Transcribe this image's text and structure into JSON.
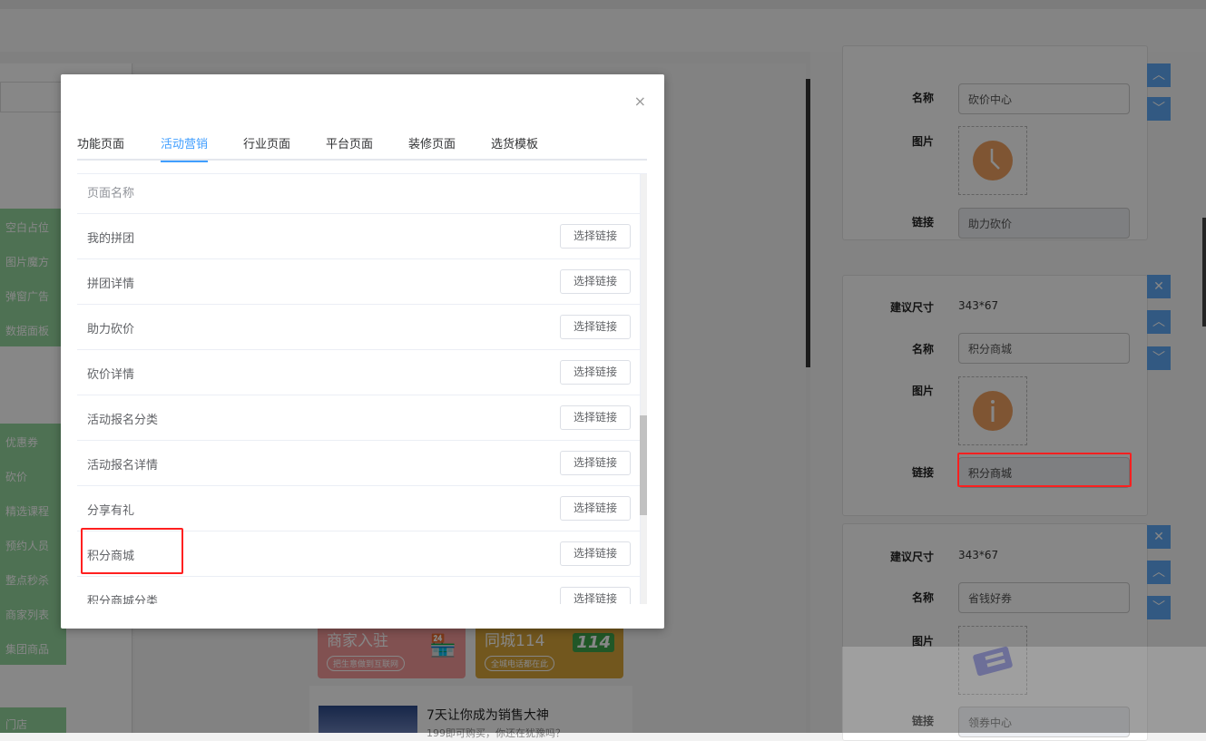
{
  "sidebar": {
    "group1": [
      "空白占位",
      "图片魔方",
      "弹窗广告",
      "数据面板"
    ],
    "group2": [
      "优惠券",
      "砍价",
      "精选课程",
      "预约人员",
      "整点秒杀",
      "商家列表",
      "集团商品"
    ],
    "group3": [
      "门店"
    ]
  },
  "preview": {
    "card1": {
      "title": "商家入驻",
      "sub": "把生意做到互联网"
    },
    "card2": {
      "title": "同城114",
      "sub": "全城电话都在此",
      "badge": "114"
    },
    "article": {
      "title": "7天让你成为销售大神",
      "sub": "199即可购买，你还在犹豫吗？"
    }
  },
  "right": {
    "labels": {
      "size": "建议尺寸",
      "name": "名称",
      "image": "图片",
      "link": "链接"
    },
    "items": [
      {
        "name": "砍价中心",
        "link": "助力砍价"
      },
      {
        "size": "343*67",
        "name": "积分商城",
        "link": "积分商城"
      },
      {
        "size": "343*67",
        "name": "省钱好券",
        "link": "领券中心"
      }
    ]
  },
  "modal": {
    "close": "×",
    "tabs": [
      "功能页面",
      "活动营销",
      "行业页面",
      "平台页面",
      "装修页面",
      "选货模板"
    ],
    "active_tab": "活动营销",
    "column": "页面名称",
    "button": "选择链接",
    "rows": [
      "我的拼团",
      "拼团详情",
      "助力砍价",
      "砍价详情",
      "活动报名分类",
      "活动报名详情",
      "分享有礼",
      "积分商城",
      "积分商城分类"
    ]
  }
}
